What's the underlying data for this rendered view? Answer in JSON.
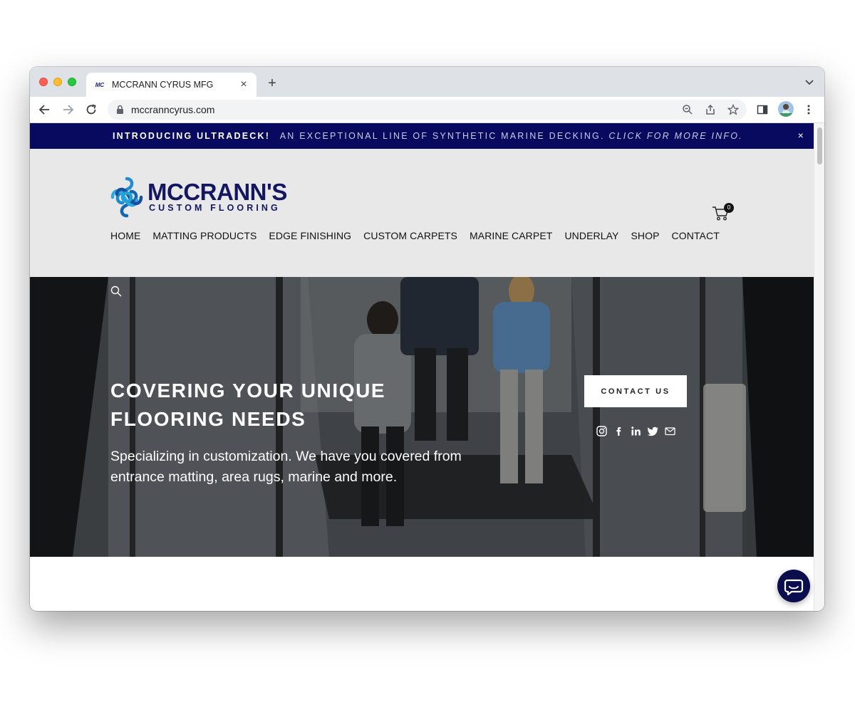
{
  "browser": {
    "tab_title": "MCCRANN CYRUS MFG",
    "tab_favicon_text": "MC",
    "url": "mccranncyrus.com"
  },
  "announcement": {
    "strong": "INTRODUCING ULTRADECK!",
    "main": "AN EXCEPTIONAL LINE OF SYNTHETIC MARINE DECKING.",
    "link": "CLICK FOR MORE INFO.",
    "close": "×"
  },
  "header": {
    "logo_word": "MCCRANN'S",
    "logo_sub": "CUSTOM FLOORING",
    "cart_count": "0",
    "nav": [
      "HOME",
      "MATTING PRODUCTS",
      "EDGE FINISHING",
      "CUSTOM CARPETS",
      "MARINE CARPET",
      "UNDERLAY",
      "SHOP",
      "CONTACT"
    ]
  },
  "hero": {
    "title": "COVERING YOUR UNIQUE FLOORING NEEDS",
    "subtitle": "Specializing in customization. We have you covered from entrance matting, area rugs, marine and more.",
    "button": "CONTACT US",
    "socials": [
      "instagram-icon",
      "facebook-icon",
      "linkedin-icon",
      "twitter-icon",
      "email-icon"
    ]
  },
  "colors": {
    "announce_bg": "#070a5e",
    "brand_navy": "#141660",
    "header_bg": "#e8e8e8",
    "chat_bg": "#0b0d4d"
  }
}
